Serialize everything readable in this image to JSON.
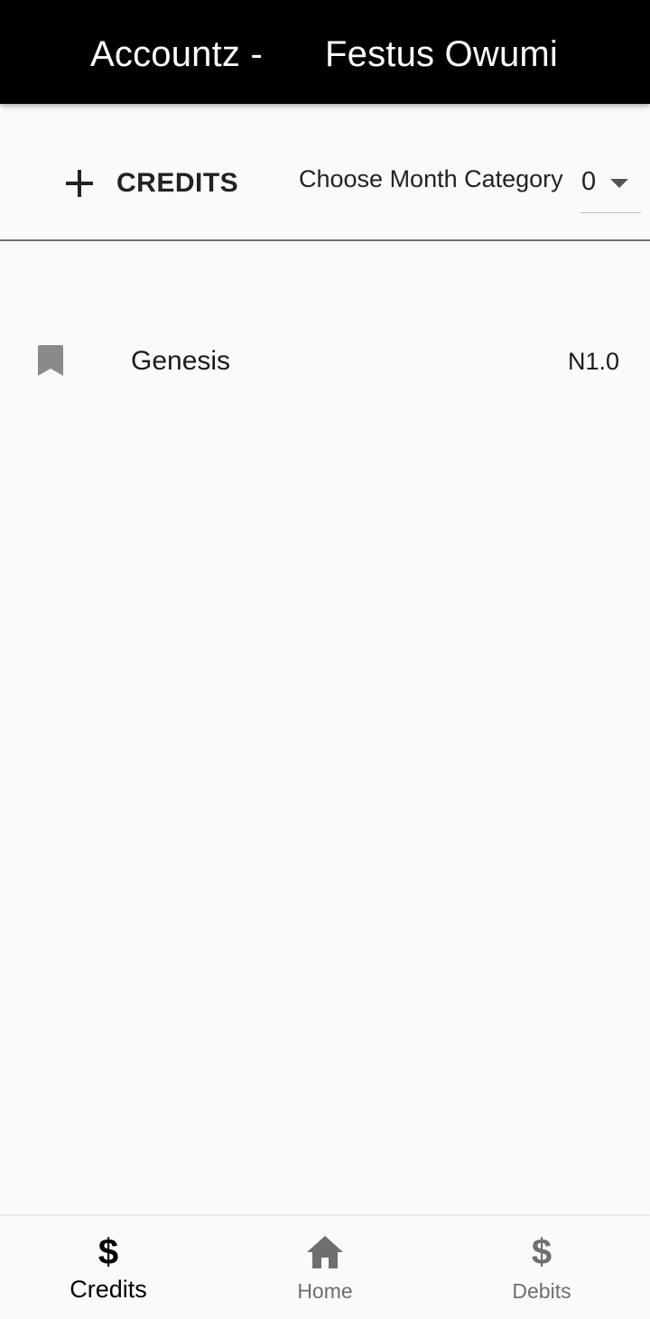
{
  "appbar": {
    "title_left": "Accountz -",
    "title_right": "Festus Owumi",
    "background": "#000000"
  },
  "toolbar": {
    "add_label": "CREDITS",
    "add_icon": "plus-icon",
    "month_prompt": "Choose Month Category",
    "month_value": "0",
    "dropdown_icon": "caret-down-icon"
  },
  "list": {
    "items": [
      {
        "icon": "bookmark-icon",
        "name": "Genesis",
        "amount": "N1.0"
      }
    ]
  },
  "bottom_nav": {
    "items": [
      {
        "label": "Credits",
        "icon": "dollar-icon",
        "active": true
      },
      {
        "label": "Home",
        "icon": "home-icon",
        "active": false
      },
      {
        "label": "Debits",
        "icon": "dollar-icon",
        "active": false
      }
    ],
    "icon_glyph": "$"
  },
  "colors": {
    "active": "#000000",
    "inactive": "#6f6f6f",
    "background": "#fafafa"
  }
}
